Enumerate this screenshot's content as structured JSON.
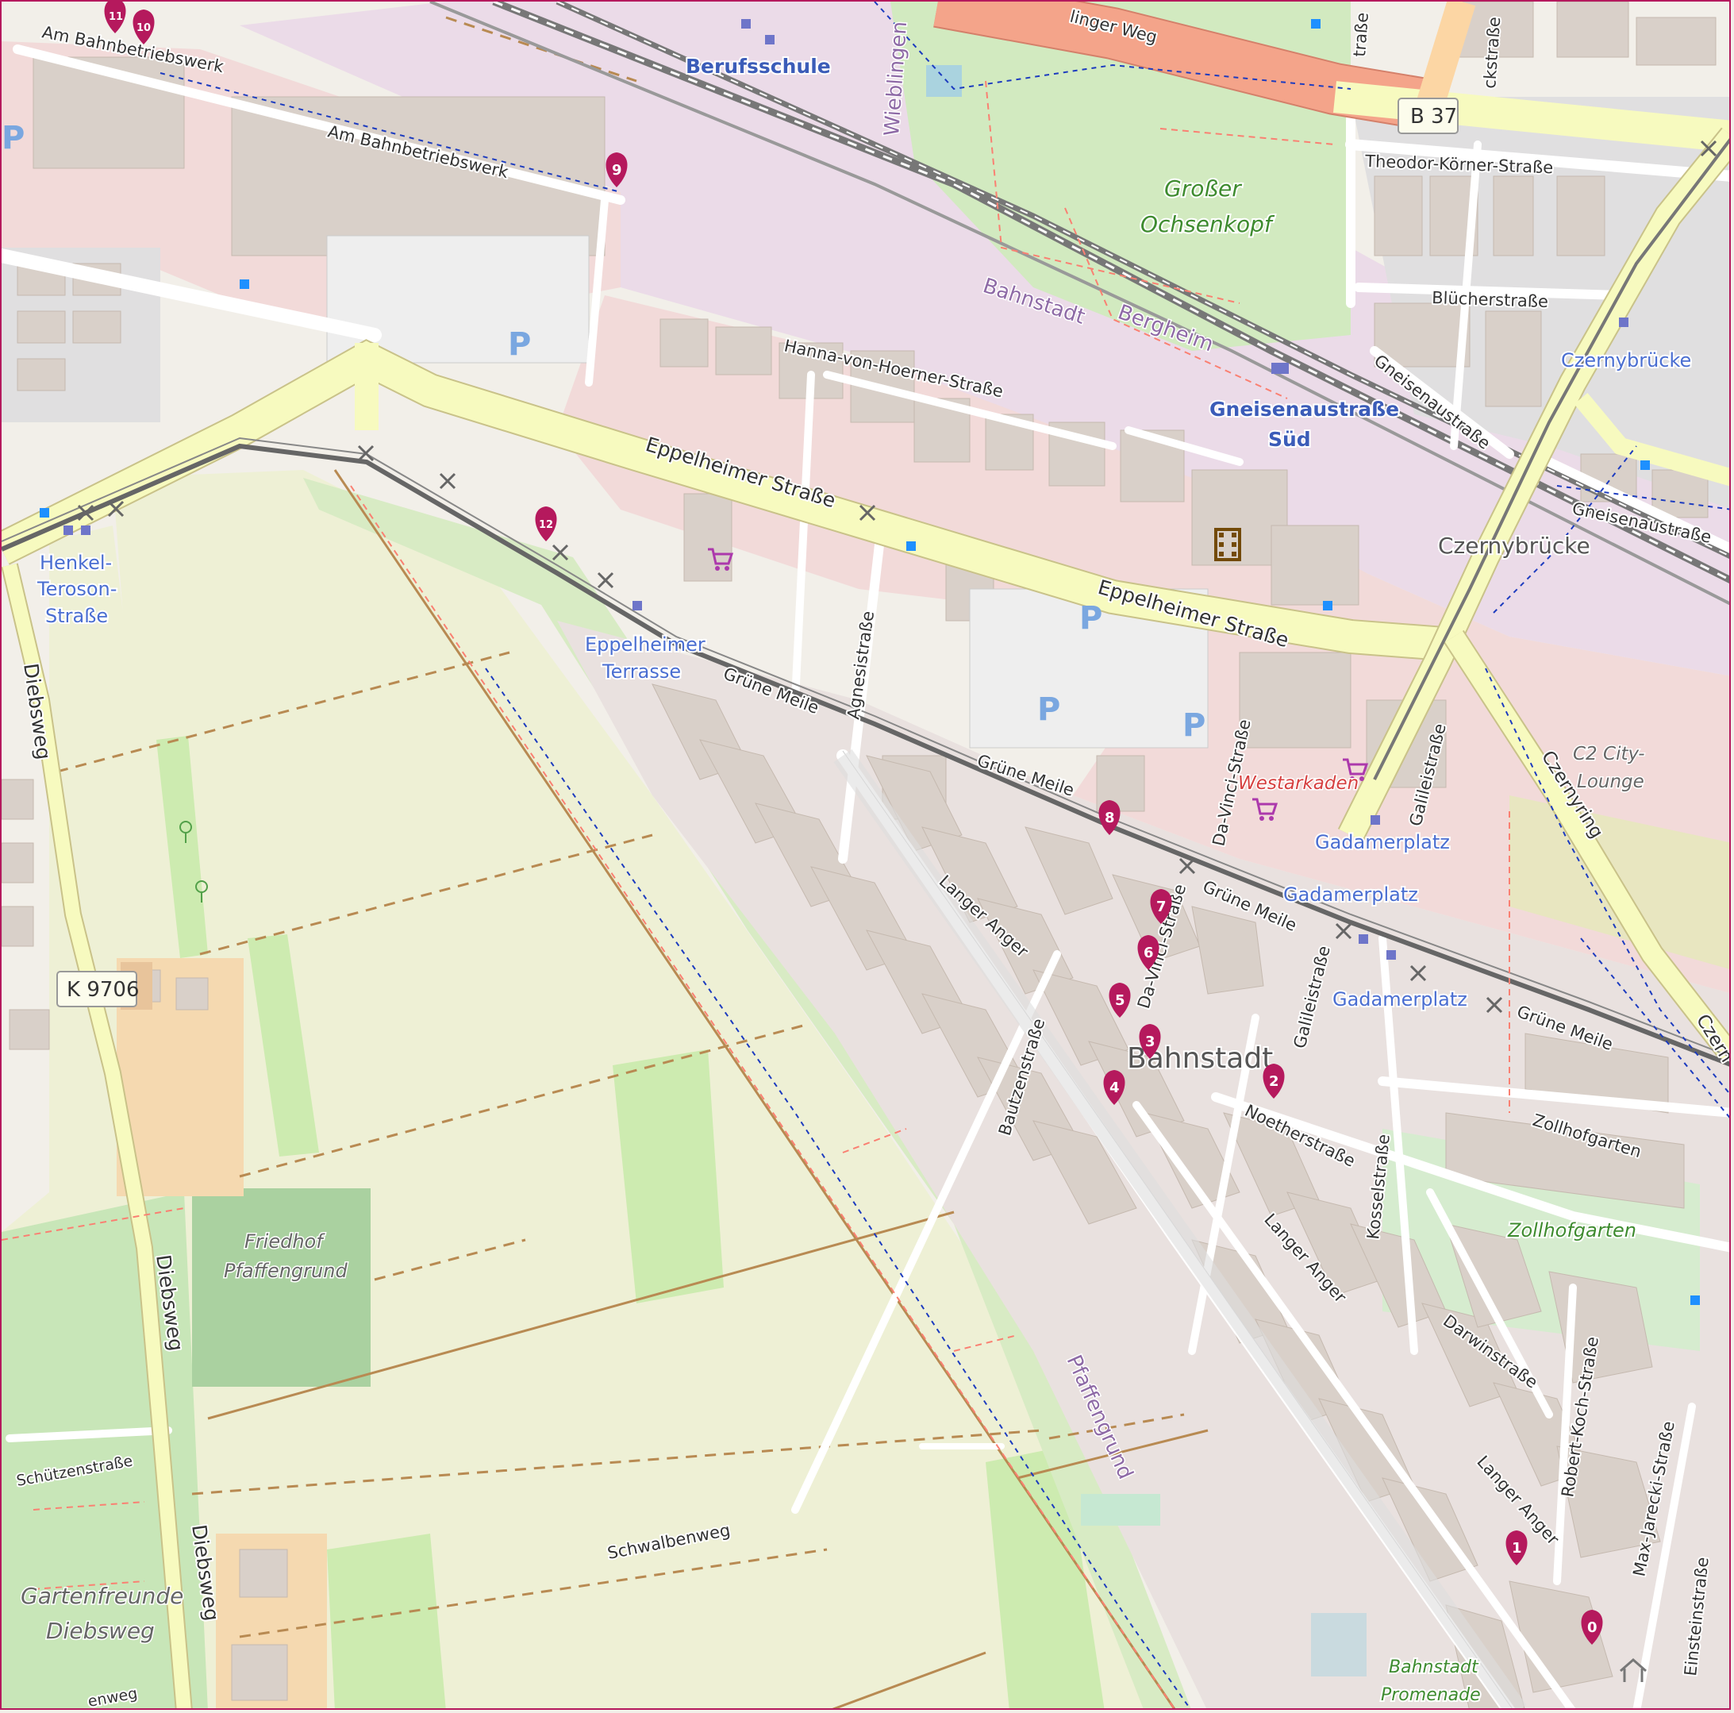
{
  "map": {
    "streets": {
      "am_bahnbetriebswerk_1": "Am Bahnbetriebswerk",
      "am_bahnbetriebswerk_2": "Am Bahnbetriebswerk",
      "hanna_von_hoerner": "Hanna-von-Hoerner-Straße",
      "eppelheimer_1": "Eppelheimer Straße",
      "eppelheimer_2": "Eppelheimer Straße",
      "gruene_meile_1": "Grüne Meile",
      "gruene_meile_2": "Grüne Meile",
      "gruene_meile_3": "Grüne Meile",
      "gruene_meile_4": "Grüne Meile",
      "agnesistrasse": "Agnesistraße",
      "langer_anger_1": "Langer Anger",
      "langer_anger_2": "Langer Anger",
      "langer_anger_3": "Langer Anger",
      "bautzenstrasse": "Bautzenstraße",
      "da_vinci_1": "Da-Vinci-Straße",
      "da_vinci_2": "Da-Vinci-Straße",
      "galileistrasse_1": "Galileistraße",
      "galileistrasse_2": "Galileistraße",
      "noetherstrasse": "Noetherstraße",
      "kosselstrasse": "Kosselstraße",
      "zollhofgarten": "Zollhofgarten",
      "darwinstrasse": "Darwinstraße",
      "robert_koch": "Robert-Koch-Straße",
      "max_jarecki": "Max-Jarecki-Straße",
      "einsteinstrasse": "Einsteinstraße",
      "czernyring_1": "Czernyring",
      "czernyring_2": "Czern",
      "theodor_koerner": "Theodor-Körner-Straße",
      "bluecherstrasse": "Blücherstraße",
      "gneisenaustrasse_1": "Gneisenaustraße",
      "gneisenaustrasse_2": "Gneisenaustraße",
      "diebsweg_1": "Diebsweg",
      "diebsweg_2": "Diebsweg",
      "diebsweg_3": "Diebsweg",
      "schuetzenstrasse": "Schützenstraße",
      "schwalbenweg": "Schwalbenweg",
      "bluemlinger_weg": "linger Weg",
      "wieblingen": "Wieblingen",
      "ckstrasse": "ckstraße",
      "strasse_top": "traße",
      "enweg": "enweg"
    },
    "shields": {
      "b37": "B 37",
      "k9706": "K 9706"
    },
    "stops": {
      "henkel": [
        "Henkel-",
        "Teroson-",
        "Straße"
      ],
      "eppelheimer_terrasse": [
        "Eppelheimer",
        "Terrasse"
      ],
      "gadamerplatz_1": "Gadamerplatz",
      "gadamerplatz_2": "Gadamerplatz",
      "gadamerplatz_3": "Gadamerplatz",
      "czernybruecke": "Czernybrücke",
      "gneisenau_sued": [
        "Gneisenaustraße",
        "Süd"
      ],
      "berufsschule": "Berufsschule"
    },
    "places": {
      "grosser_ochsenkopf": [
        "Großer",
        "Ochsenkopf"
      ],
      "bahnstadt_district": "Bahnstadt",
      "bahnstadt_big": "Bahnstadt",
      "bergheim": "Bergheim",
      "czernybruecke_big": "Czernybrücke",
      "c2_lounge": [
        "C2 City-",
        "Lounge"
      ],
      "westarkaden": "Westarkaden",
      "friedhof": [
        "Friedhof",
        "Pfaffengrund"
      ],
      "gartenfreunde": [
        "Gartenfreunde",
        "Diebsweg"
      ],
      "pfaffengrund": "Pfaffengrund",
      "zollhofgarten_park": "Zollhofgarten",
      "promenade": [
        "Bahnstadt",
        "Promenade"
      ]
    },
    "parking_label": "P",
    "markers": [
      "0",
      "1",
      "2",
      "3",
      "4",
      "5",
      "6",
      "7",
      "8",
      "9",
      "10",
      "11",
      "12"
    ],
    "colors": {
      "marker": "#b5195d",
      "primary_road": "#f7fabf",
      "trunk_road": "#f4a48a",
      "railway": "#777777",
      "residential_area": "#f2dad9",
      "farmland": "#eef0d5",
      "park": "#c8facc",
      "building": "#d9d0c9"
    }
  }
}
